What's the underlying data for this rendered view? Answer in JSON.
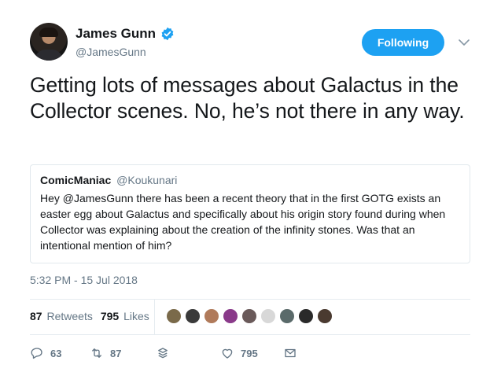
{
  "user": {
    "name": "James Gunn",
    "handle": "@JamesGunn"
  },
  "follow_button": {
    "label": "Following"
  },
  "tweet": {
    "text": "Getting lots of messages about Galactus in the Collector scenes. No, he’s not there in any way.",
    "timestamp": "5:32 PM - 15 Jul 2018"
  },
  "quoted_tweet": {
    "name": "ComicManiac",
    "handle": "@Koukunari",
    "text": "Hey @JamesGunn there has been a recent theory that in the first GOTG exists an easter egg about Galactus and specifically about his origin story found during when Collector was explaining about the creation of the infinity stones. Was that an intentional mention of him?"
  },
  "stats": {
    "retweets_count": "87",
    "retweets_label": "Retweets",
    "likes_count": "795",
    "likes_label": "Likes"
  },
  "actions": {
    "reply_count": "63",
    "retweet_count": "87",
    "like_count": "795"
  },
  "colors": {
    "accent": "#1da1f2",
    "secondary_text": "#657786"
  }
}
